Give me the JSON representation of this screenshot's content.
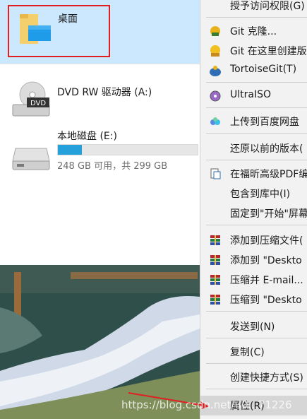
{
  "explorer": {
    "desktop_label": "桌面",
    "drives": [
      {
        "name": "DVD RW 驱动器 (A:)"
      },
      {
        "name": "本地磁盘 (E:)",
        "info": "248 GB 可用，共 299 GB",
        "used_fraction": 0.17
      }
    ]
  },
  "context_menu": {
    "items": [
      {
        "label": "授予访问权限(G)",
        "icon": ""
      },
      {
        "label": "Git 克隆...",
        "icon": "git-clone-icon"
      },
      {
        "label": "Git 在这里创建版",
        "icon": "git-create-icon"
      },
      {
        "label": "TortoiseGit(T)",
        "icon": "tortoisegit-icon"
      },
      {
        "label": "UltraISO",
        "icon": "ultraiso-icon"
      },
      {
        "label": "上传到百度网盘",
        "icon": "baidu-netdisk-icon"
      },
      {
        "label": "还原以前的版本(",
        "icon": ""
      },
      {
        "label": "在福昕高级PDF编",
        "icon": "foxit-pdf-icon"
      },
      {
        "label": "包含到库中(I)",
        "icon": ""
      },
      {
        "label": "固定到\"开始\"屏幕",
        "icon": ""
      },
      {
        "label": "添加到压缩文件(",
        "icon": "winrar-icon"
      },
      {
        "label": "添加到 \"Deskto",
        "icon": "winrar-icon"
      },
      {
        "label": "压缩并 E-mail...",
        "icon": "winrar-icon"
      },
      {
        "label": "压缩到 \"Deskto",
        "icon": "winrar-icon"
      },
      {
        "label": "发送到(N)",
        "icon": ""
      },
      {
        "label": "复制(C)",
        "icon": ""
      },
      {
        "label": "创建快捷方式(S)",
        "icon": ""
      },
      {
        "label": "属性(R)",
        "icon": ""
      }
    ]
  },
  "watermark": "https://blog.csdn.net/u0...71226"
}
